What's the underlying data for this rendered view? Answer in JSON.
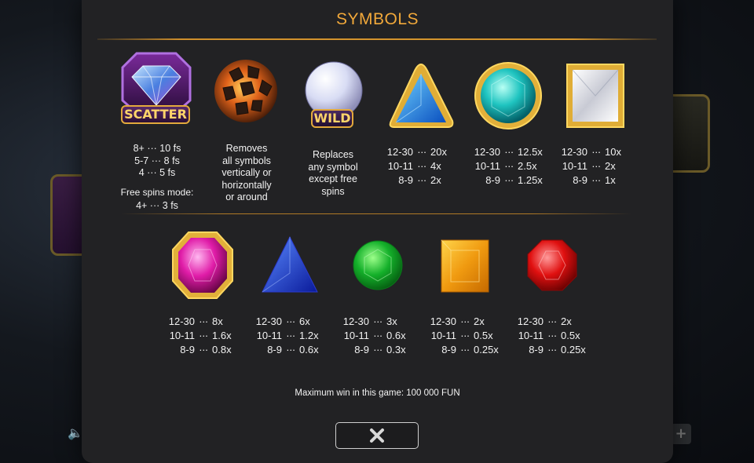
{
  "title": "SYMBOLS",
  "scatter": {
    "badge": "SCATTER",
    "lines": [
      "8+ ··· 10 fs",
      "5-7 ··· 8 fs",
      "4 ··· 5 fs"
    ],
    "mode_label": "Free spins mode:",
    "mode_line": "4+ ··· 3 fs"
  },
  "bomb": {
    "desc": [
      "Removes",
      "all symbols",
      "vertically or",
      "horizontally",
      "or around"
    ]
  },
  "wild": {
    "badge": "WILD",
    "desc": [
      "Replaces",
      "any symbol",
      "except free",
      "spins"
    ]
  },
  "paytables": [
    {
      "symbol": "blue-triangle-gem",
      "rows": [
        [
          "12-30",
          "20x"
        ],
        [
          "10-11",
          "4x"
        ],
        [
          "8-9",
          "2x"
        ]
      ]
    },
    {
      "symbol": "cyan-round-gem",
      "rows": [
        [
          "12-30",
          "12.5x"
        ],
        [
          "10-11",
          "2.5x"
        ],
        [
          "8-9",
          "1.25x"
        ]
      ]
    },
    {
      "symbol": "white-square-gem",
      "rows": [
        [
          "12-30",
          "10x"
        ],
        [
          "10-11",
          "2x"
        ],
        [
          "8-9",
          "1x"
        ]
      ]
    },
    {
      "symbol": "pink-octagon-gem",
      "rows": [
        [
          "12-30",
          "8x"
        ],
        [
          "10-11",
          "1.6x"
        ],
        [
          "8-9",
          "0.8x"
        ]
      ]
    },
    {
      "symbol": "dark-blue-triangle-gem",
      "rows": [
        [
          "12-30",
          "6x"
        ],
        [
          "10-11",
          "1.2x"
        ],
        [
          "8-9",
          "0.6x"
        ]
      ]
    },
    {
      "symbol": "green-round-gem",
      "rows": [
        [
          "12-30",
          "3x"
        ],
        [
          "10-11",
          "0.6x"
        ],
        [
          "8-9",
          "0.3x"
        ]
      ]
    },
    {
      "symbol": "orange-square-gem",
      "rows": [
        [
          "12-30",
          "2x"
        ],
        [
          "10-11",
          "0.5x"
        ],
        [
          "8-9",
          "0.25x"
        ]
      ]
    },
    {
      "symbol": "red-round-gem",
      "rows": [
        [
          "12-30",
          "2x"
        ],
        [
          "10-11",
          "0.5x"
        ],
        [
          "8-9",
          "0.25x"
        ]
      ]
    }
  ],
  "dots": "···",
  "footer": "Maximum win in this game: 100 000 FUN",
  "close_icon": "close-x-icon",
  "colors": {
    "title": "#f1a83a",
    "panel": "#222224",
    "gold": "#e3a93c"
  }
}
